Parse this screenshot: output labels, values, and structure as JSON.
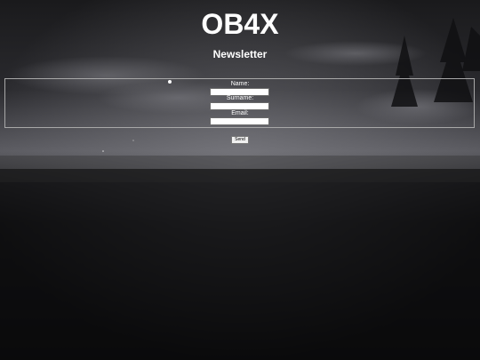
{
  "header": {
    "title": "OB4X",
    "subtitle": "Newsletter"
  },
  "form": {
    "fields": [
      {
        "label": "Name:",
        "value": ""
      },
      {
        "label": "Surname:",
        "value": ""
      },
      {
        "label": "Email:",
        "value": ""
      }
    ],
    "send_label": "Send"
  },
  "colors": {
    "background": "#0c0c0d",
    "text": "#ffffff",
    "fieldset_border": "#a8a8a8"
  }
}
